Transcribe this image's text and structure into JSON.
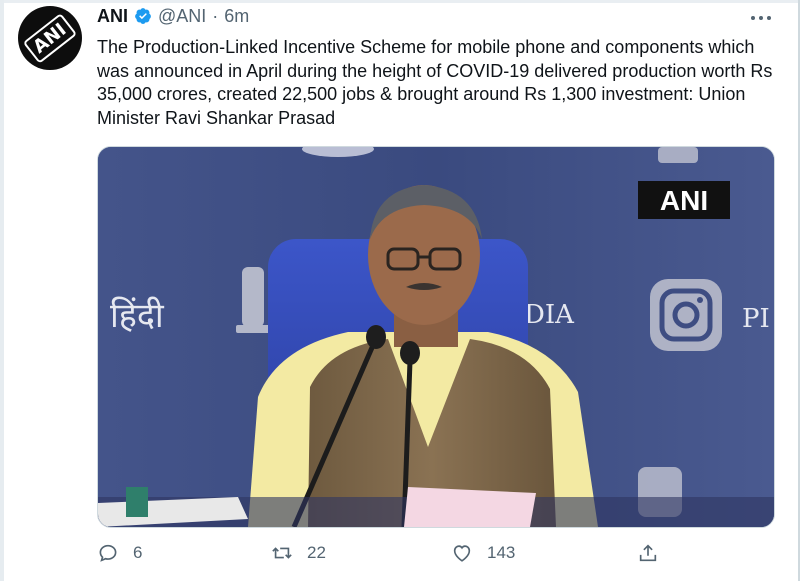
{
  "tweet": {
    "author": "ANI",
    "handle": "@ANI",
    "separator": "·",
    "time": "6m",
    "text": "The Production-Linked Incentive Scheme for mobile phone and components which was announced in April during the height of COVID-19 delivered production worth Rs 35,000 crores, created 22,500 jobs & brought around Rs 1,300 investment: Union Minister Ravi Shankar Prasad",
    "media": {
      "watermark": "ANI",
      "backdrop_hindi": "हिंदी",
      "backdrop_india": "DIA",
      "backdrop_pi": "PI"
    },
    "actions": {
      "replies": "6",
      "retweets": "22",
      "likes": "143"
    }
  },
  "colors": {
    "brand_blue": "#1d9bf0",
    "muted": "#536471",
    "backdrop": "#3a4a7d"
  },
  "icons": [
    "verified-badge-icon",
    "more-icon",
    "reply-icon",
    "retweet-icon",
    "like-icon",
    "share-icon",
    "instagram-icon"
  ]
}
